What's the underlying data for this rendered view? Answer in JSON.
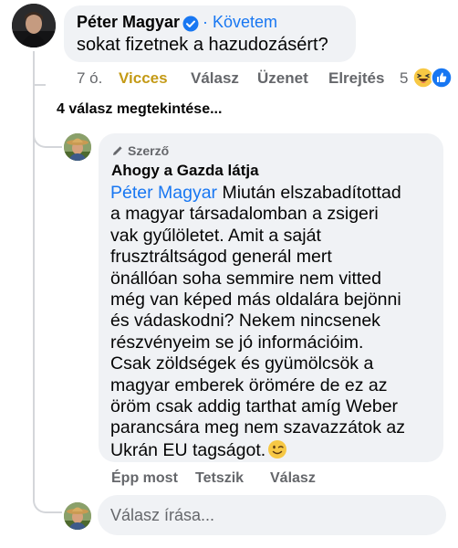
{
  "comment": {
    "author": "Péter Magyar",
    "follow_label": "· Követem",
    "text": "sokat fizetnek a hazudozásért?",
    "time": "7 ó.",
    "reaction_label": "Vicces",
    "reply_label": "Válasz",
    "message_label": "Üzenet",
    "hide_label": "Elrejtés",
    "reaction_count": "5",
    "reaction_icons": [
      "haha-icon",
      "like-icon"
    ]
  },
  "view_replies": "4 válasz megtekintése...",
  "reply": {
    "badge": "Szerző",
    "author": "Ahogy a Gazda látja",
    "mention": "Péter Magyar",
    "lines": [
      " Miután elszabadítottad",
      "a magyar társadalomban a zsigeri",
      "vak gyűlöletet. Amit a saját",
      "frusztráltságod generál mert",
      "önállóan soha semmire nem vitted",
      "még van képed más oldalára bejönni",
      "és vádaskodni? Nekem nincsenek",
      "részvényeim se jó információim.",
      "Csak zöldségek és gyümölcsök a",
      "magyar emberek örömére de ez az",
      "öröm csak addig tarthat amíg Weber",
      "parancsára meg nem szavazzátok az",
      "Ukrán EU tagságot."
    ],
    "emoji": "wink-emoji",
    "time": "Épp most",
    "like_label": "Tetszik",
    "reply_label": "Válasz"
  },
  "input": {
    "placeholder": "Válasz írása..."
  },
  "colors": {
    "accent": "#1877f2",
    "vicces": "#c49a16",
    "secondary_text": "#65676b",
    "bubble": "#f0f2f5"
  }
}
